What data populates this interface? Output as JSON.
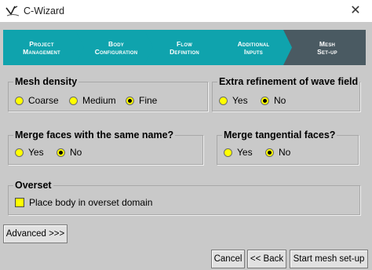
{
  "window": {
    "title": "C-Wizard",
    "close_glyph": "✕"
  },
  "wizard_steps": [
    {
      "line1": "Project",
      "line2": "Management"
    },
    {
      "line1": "Body",
      "line2": "Configuration"
    },
    {
      "line1": "Flow",
      "line2": "Definition"
    },
    {
      "line1": "Additional",
      "line2": "Inputs"
    },
    {
      "line1": "Mesh",
      "line2": "Set-up",
      "active": true
    }
  ],
  "colors": {
    "step": "#0fa3ad",
    "step_active": "#4a5a62",
    "option": "#ffff00",
    "background": "#c9c9c9"
  },
  "mesh_density": {
    "title": "Mesh density",
    "options": [
      {
        "label": "Coarse"
      },
      {
        "label": "Medium"
      },
      {
        "label": "Fine",
        "selected": true
      }
    ]
  },
  "wave_field": {
    "title": "Extra refinement of wave field",
    "options": [
      {
        "label": "Yes"
      },
      {
        "label": "No",
        "selected": true
      }
    ]
  },
  "merge_same_name": {
    "title": "Merge faces with the same name?",
    "options": [
      {
        "label": "Yes"
      },
      {
        "label": "No",
        "selected": true
      }
    ]
  },
  "merge_tangential": {
    "title": "Merge tangential faces?",
    "options": [
      {
        "label": "Yes"
      },
      {
        "label": "No",
        "selected": true
      }
    ]
  },
  "overset": {
    "title": "Overset",
    "checkbox_label": "Place body in overset domain",
    "checked": false
  },
  "buttons": {
    "advanced": "Advanced >>>",
    "cancel": "Cancel",
    "back": "<< Back",
    "start": "Start mesh set-up"
  }
}
